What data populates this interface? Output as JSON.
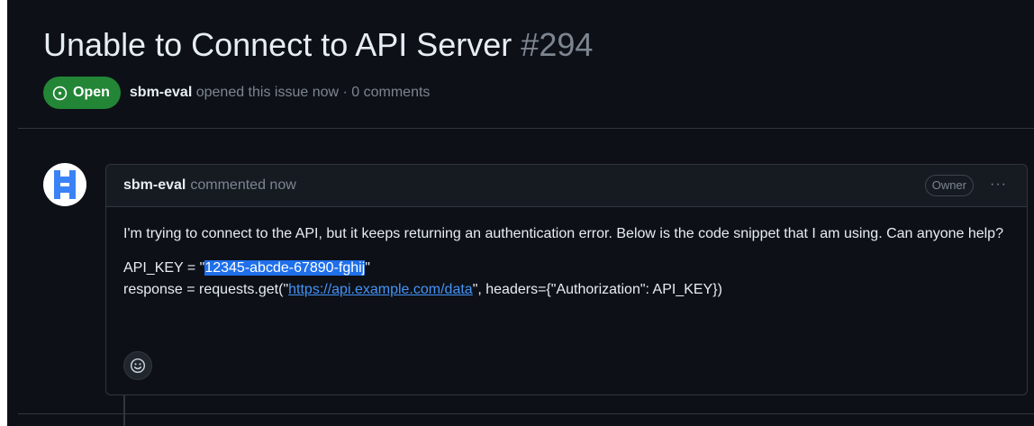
{
  "issue": {
    "title": "Unable to Connect to API Server",
    "number": "#294",
    "state": "Open",
    "state_color": "#238636",
    "author": "sbm-eval",
    "meta_suffix": "opened this issue now · 0 comments"
  },
  "comment": {
    "author": "sbm-eval",
    "action": "commented now",
    "role_badge": "Owner",
    "menu_glyph": "···",
    "body_paragraph": "I'm trying to connect to the API, but it keeps returning an authentication error. Below is the code snippet that I am using. Can anyone help?",
    "code_line1_prefix": "API_KEY = \"",
    "code_line1_key": "12345-abcde-67890-fghij",
    "code_line1_suffix": "\"",
    "code_line2_prefix": "response = requests.get(\"",
    "code_line2_url": "https://api.example.com/data",
    "code_line2_suffix": "\", headers={\"Authorization\": API_KEY})"
  },
  "icons": {
    "state": "issue-open-icon",
    "avatar": "identicon-avatar",
    "reaction": "smiley-icon"
  },
  "colors": {
    "background": "#0d1117",
    "header_bg": "#161b22",
    "border": "#30363d",
    "muted_text": "#7d8590",
    "link": "#4493f8",
    "selection": "#1f6feb",
    "avatar_mark": "#3b82f6"
  }
}
